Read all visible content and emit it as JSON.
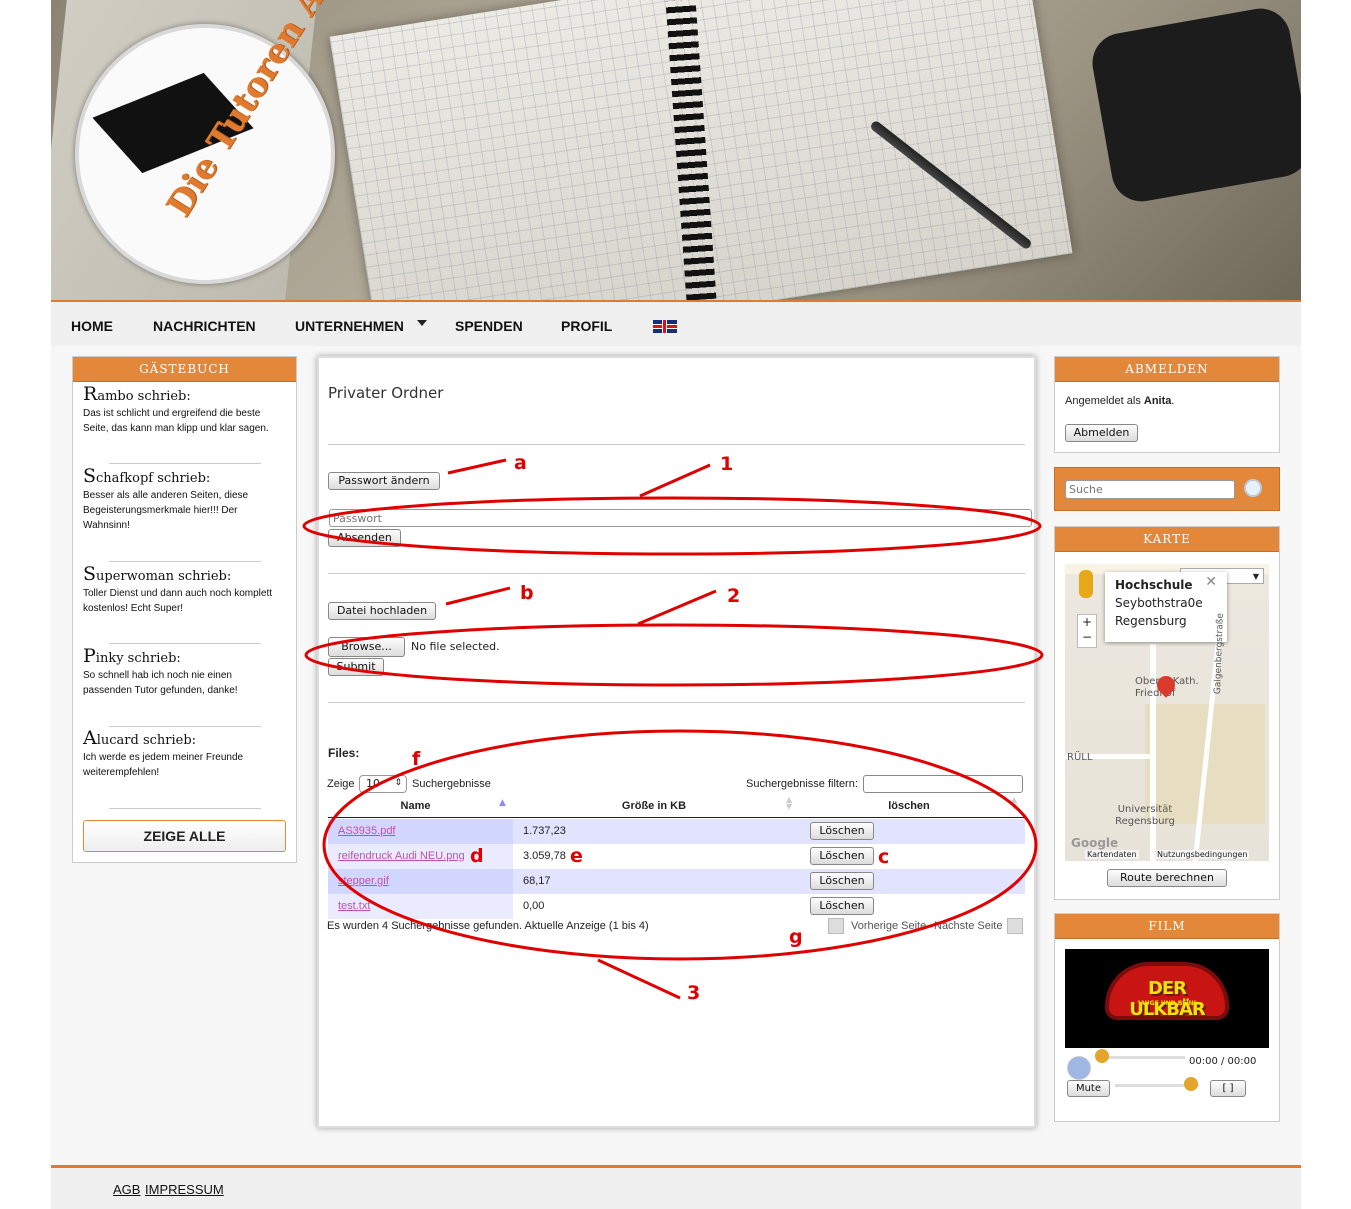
{
  "header": {
    "logo_text": "Die Tutoren AG"
  },
  "nav": {
    "items": [
      "HOME",
      "NACHRICHTEN",
      "UNTERNEHMEN",
      "SPENDEN",
      "PROFIL"
    ],
    "language_flag": "uk-flag-icon"
  },
  "guestbook": {
    "title": "GÄSTEBUCH",
    "entries": [
      {
        "initial": "R",
        "name_rest": "ambo schrieb:",
        "text": "Das ist schlicht und ergreifend die beste Seite, das kann man klipp und klar sagen."
      },
      {
        "initial": "S",
        "name_rest": "chafkopf schrieb:",
        "text": "Besser als alle anderen Seiten, diese Begeisterungsmerkmale hier!!! Der Wahnsinn!"
      },
      {
        "initial": "S",
        "name_rest": "uperwoman schrieb:",
        "text": "Toller Dienst und dann auch noch komplett kostenlos! Echt Super!"
      },
      {
        "initial": "P",
        "name_rest": "inky schrieb:",
        "text": "So schnell hab ich noch nie einen passenden Tutor gefunden, danke!"
      },
      {
        "initial": "A",
        "name_rest": "lucard schrieb:",
        "text": "Ich werde es jedem meiner Freunde weiterempfehlen!"
      }
    ],
    "show_all": "ZEIGE ALLE"
  },
  "main": {
    "title": "Privater Ordner",
    "password_button": "Passwort ändern",
    "password_placeholder": "Passwort",
    "send_button": "Absenden",
    "upload_button": "Datei hochladen",
    "browse_button": "Browse...",
    "no_file": "No file selected.",
    "submit_button": "Submit",
    "files_label": "Files:",
    "table": {
      "show_prefix": "Zeige",
      "page_size": "10",
      "show_suffix": "Suchergebnisse",
      "filter_label": "Suchergebnisse filtern:",
      "columns": [
        "Name",
        "Größe in KB",
        "löschen"
      ],
      "rows": [
        {
          "name": "AS3935.pdf",
          "size": "1.737,23",
          "action": "Löschen"
        },
        {
          "name": "reifendruck Audi NEU.png",
          "size": "3.059,78",
          "action": "Löschen"
        },
        {
          "name": "stepper.gif",
          "size": "68,17",
          "action": "Löschen"
        },
        {
          "name": "test.txt",
          "size": "0,00",
          "action": "Löschen"
        }
      ],
      "info": "Es wurden 4 Suchergebnisse gefunden. Aktuelle Anzeige (1 bis 4)",
      "prev": "Vorherige Seite",
      "next": "Nächste Seite"
    }
  },
  "annotations": {
    "a": "a",
    "b": "b",
    "c": "c",
    "d": "d",
    "e": "e",
    "f": "f",
    "g": "g",
    "n1": "1",
    "n2": "2",
    "n3": "3",
    "color": "#e00000"
  },
  "logout": {
    "title": "ABMELDEN",
    "logged_in_prefix": "Angemeldet als",
    "user": "Anita",
    "suffix": ".",
    "button": "Abmelden"
  },
  "search": {
    "placeholder": "Suche"
  },
  "map": {
    "title": "KARTE",
    "type": "Karte",
    "popup_title": "Hochschule",
    "popup_line1": "Seybothstra0e",
    "popup_line2": "Regensburg",
    "labels": [
      "Oberer Kath. Friedhof",
      "Galgenbergstraße",
      "Universität Regensburg",
      "RÜLL"
    ],
    "google": "Google",
    "attribution_data": "Kartendaten",
    "attribution_terms": "Nutzungsbedingungen",
    "route_button": "Route berechnen"
  },
  "film": {
    "title": "FILM",
    "video_title": "DER ULKBÄR",
    "video_subtitle": "\"AUGE UND BEIN\"",
    "time": "00:00 / 00:00",
    "mute": "Mute",
    "fullscreen": "[  ]",
    "volume_level": 0.9
  },
  "footer": {
    "links": [
      "AGB",
      "IMPRESSUM"
    ]
  },
  "colors": {
    "accent": "#e3883a",
    "link": "#c051a8",
    "row_odd": "#e2e4ff"
  }
}
